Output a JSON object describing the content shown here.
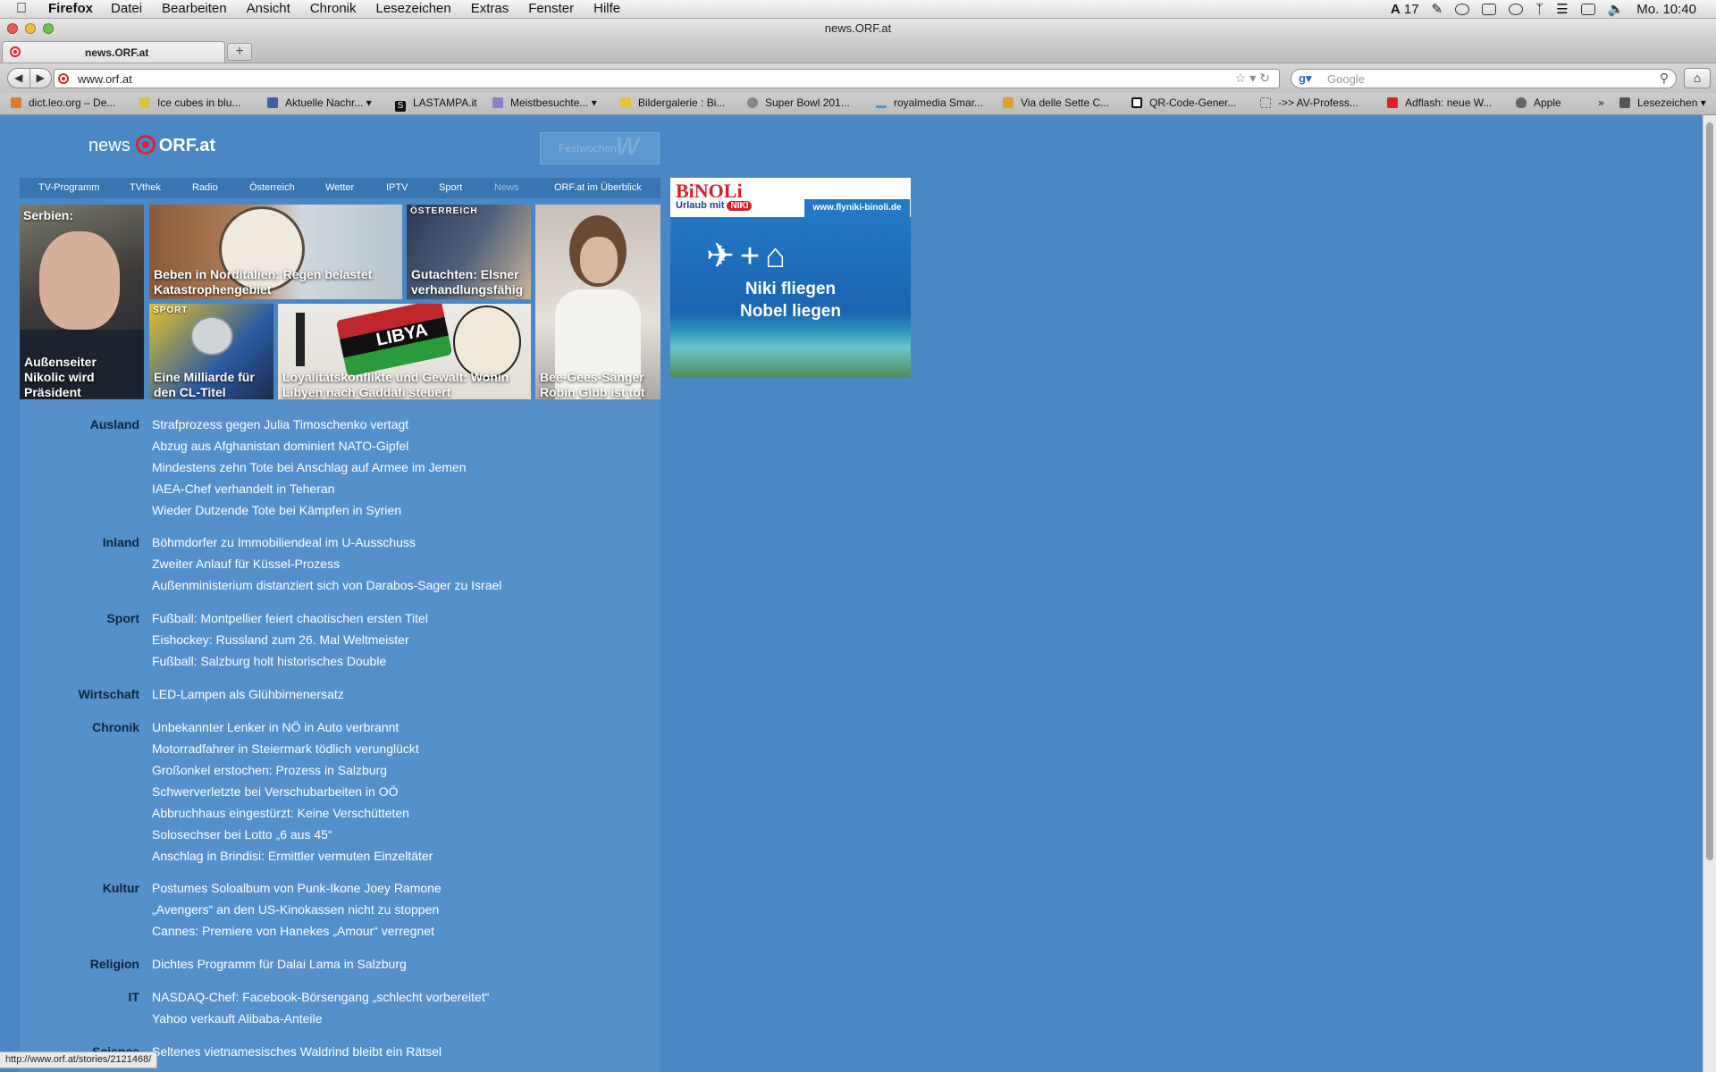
{
  "menubar": {
    "app": "Firefox",
    "menus": [
      "Datei",
      "Bearbeiten",
      "Ansicht",
      "Chronik",
      "Lesezeichen",
      "Extras",
      "Fenster",
      "Hilfe"
    ],
    "status_count": "17",
    "clock": "Mo. 10:40"
  },
  "window": {
    "title": "news.ORF.at"
  },
  "tab": {
    "label": "news.ORF.at",
    "new_tab": "+"
  },
  "navbar": {
    "url": "www.orf.at",
    "search_placeholder": "Google"
  },
  "bookmarks": {
    "items": [
      "dict.leo.org – De...",
      "Ice cubes in blu...",
      "Aktuelle Nachr...",
      "LASTAMPA.it",
      "Meistbesuchte...",
      "Bildergalerie : Bi...",
      "Super Bowl 201...",
      "royalmedia Smar...",
      "Via delle Sette C...",
      "QR-Code-Gener...",
      "->> AV-Profess...",
      "Adflash: neue W...",
      "Apple"
    ],
    "overflow": "»",
    "folder": "Lesezeichen"
  },
  "page": {
    "logo": {
      "news": "news",
      "orf": "ORF.at"
    },
    "festwochen": "Festwochen",
    "topnav": [
      "TV-Programm",
      "TVthek",
      "Radio",
      "Österreich",
      "Wetter",
      "IPTV",
      "Sport",
      "News",
      "ORF.at im Überblick"
    ],
    "tiles": {
      "nikolic": {
        "lead": "Serbien:",
        "caption": "Außenseiter Nikolic wird Präsident"
      },
      "beben": {
        "caption": "Beben in Norditalien: Regen belastet Katastrophengebiet"
      },
      "elsner": {
        "tag": "ÖSTERREICH",
        "caption": "Gutachten: Elsner verhandlungsfähig"
      },
      "gibb": {
        "caption": "Bee-Gees-Sänger Robin Gibb ist tot"
      },
      "cl": {
        "tag": "SPORT",
        "caption": "Eine Milliarde für den CL-Titel"
      },
      "libyen": {
        "caption": "Loyalitätskonflikte und Gewalt: Wohin Libyen nach Gaddafi steuert",
        "flag_text": "LIBYA"
      }
    },
    "sections": [
      {
        "name": "Ausland",
        "links": [
          "Strafprozess gegen Julia Timoschenko vertagt",
          "Abzug aus Afghanistan dominiert NATO-Gipfel",
          "Mindestens zehn Tote bei Anschlag auf Armee im Jemen",
          "IAEA-Chef verhandelt in Teheran",
          "Wieder Dutzende Tote bei Kämpfen in Syrien"
        ]
      },
      {
        "name": "Inland",
        "links": [
          "Böhmdorfer zu Immobiliendeal im U-Ausschuss",
          "Zweiter Anlauf für Küssel-Prozess",
          "Außenministerium distanziert sich von Darabos-Sager zu Israel"
        ]
      },
      {
        "name": "Sport",
        "links": [
          "Fußball: Montpellier feiert chaotischen ersten Titel",
          "Eishockey: Russland zum 26. Mal Weltmeister",
          "Fußball: Salzburg holt historisches Double"
        ]
      },
      {
        "name": "Wirtschaft",
        "links": [
          "LED-Lampen als Glühbirnenersatz"
        ]
      },
      {
        "name": "Chronik",
        "links": [
          "Unbekannter Lenker in NÖ in Auto verbrannt",
          "Motorradfahrer in Steiermark tödlich verunglückt",
          "Großonkel erstochen: Prozess in Salzburg",
          "Schwerverletzte bei Verschubarbeiten in OÖ",
          "Abbruchhaus eingestürzt: Keine Verschütteten",
          "Solosechser bei Lotto „6 aus 45“",
          "Anschlag in Brindisi: Ermittler vermuten Einzeltäter"
        ]
      },
      {
        "name": "Kultur",
        "links": [
          "Postumes Soloalbum von Punk-Ikone Joey Ramone",
          "„Avengers“ an den US-Kinokassen nicht zu stoppen",
          "Cannes: Premiere von Hanekes „Amour“ verregnet"
        ]
      },
      {
        "name": "Religion",
        "links": [
          "Dichtes Programm für Dalai Lama in Salzburg"
        ]
      },
      {
        "name": "IT",
        "links": [
          "NASDAQ-Chef: Facebook-Börsengang „schlecht vorbereitet“",
          "Yahoo verkauft Alibaba-Anteile"
        ]
      },
      {
        "name": "Science",
        "links": [
          "Seltenes vietnamesisches Waldrind bleibt ein Rätsel"
        ]
      }
    ],
    "ad": {
      "brand": "BiNOLi",
      "sub": "Urlaub mit",
      "niki": "NIKI",
      "url": "www.flyniki-binoli.de",
      "line1": "Niki fliegen",
      "line2": "Nobel liegen"
    }
  },
  "statusbar": "http://www.orf.at/stories/2121468/",
  "colors": {
    "page_bg": "#4a87c4",
    "list_bg": "#5590cb",
    "nav_bg": "#3a74b0",
    "orf_red": "#d9262c"
  }
}
